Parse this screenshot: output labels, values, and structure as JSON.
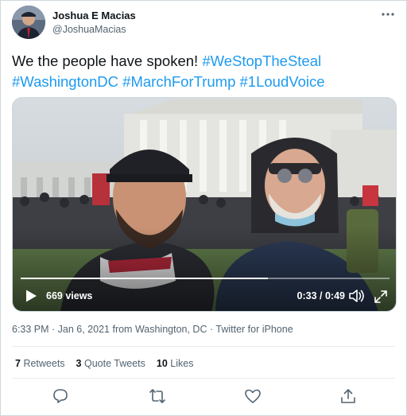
{
  "user": {
    "name": "Joshua E Macias",
    "handle": "@JoshuaMacias"
  },
  "tweet": {
    "text_plain": "We the people have spoken! ",
    "hashtags": [
      "#WeStopTheSteal",
      "#WashingtonDC",
      "#MarchForTrump",
      "#1LoudVoice"
    ]
  },
  "video": {
    "views": "669 views",
    "time": "0:33 / 0:49",
    "progress": 0.67
  },
  "meta": {
    "timestamp": "6:33 PM · Jan 6, 2021 from Washington, DC · ",
    "source": "Twitter for iPhone"
  },
  "stats": {
    "retweets_count": "7",
    "retweets_label": "Retweets",
    "quotes_count": "3",
    "quotes_label": "Quote Tweets",
    "likes_count": "10",
    "likes_label": "Likes"
  },
  "colors": {
    "link": "#1d9bf0",
    "text": "#0f1419",
    "muted": "#536471"
  },
  "icons": [
    "more-icon",
    "play-icon",
    "volume-icon",
    "fullscreen-icon",
    "reply-icon",
    "retweet-icon",
    "like-icon",
    "share-icon"
  ]
}
